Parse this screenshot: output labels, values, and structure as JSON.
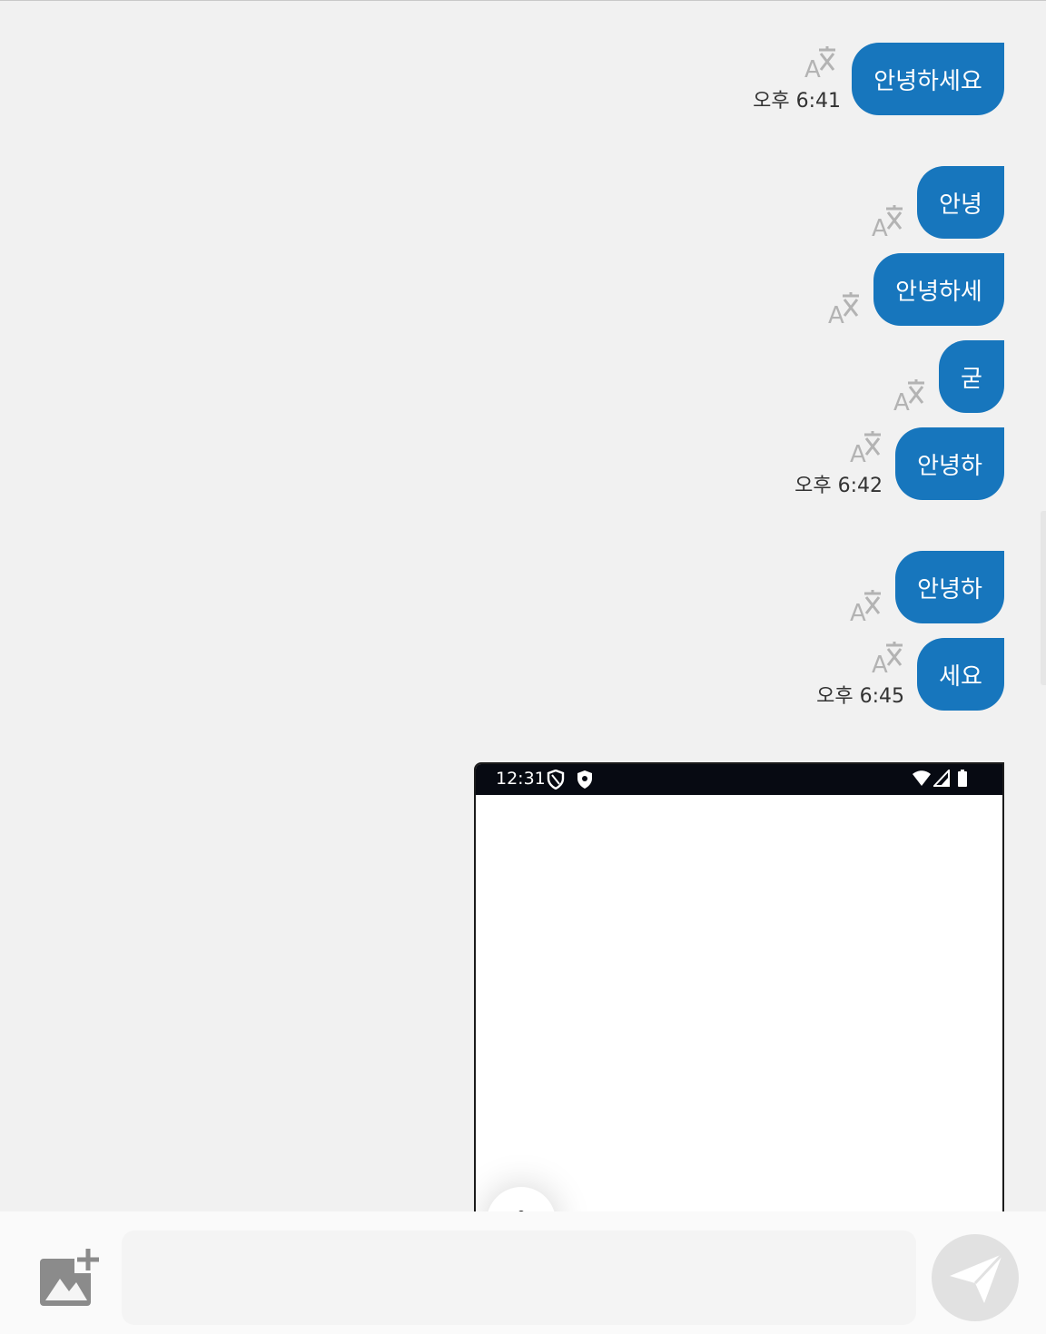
{
  "messages": [
    {
      "text": "안녕하세요",
      "time": "오후 6:41"
    },
    {
      "text": "안녕",
      "time": ""
    },
    {
      "text": "안녕하세",
      "time": ""
    },
    {
      "text": "굳",
      "time": ""
    },
    {
      "text": "안녕하",
      "time": "오후 6:42"
    },
    {
      "text": "안녕하",
      "time": ""
    },
    {
      "text": "세요",
      "time": "오후 6:45"
    }
  ],
  "screenshot_message": {
    "status_time": "12:31"
  },
  "composer": {
    "input_value": "",
    "input_placeholder": ""
  },
  "colors": {
    "bubble": "#1776bd",
    "background": "#f1f1f1",
    "translate_icon": "#b3b3b3",
    "send_button": "#e1e1e1"
  },
  "icons": {
    "translate": "translate-icon",
    "add_image": "add-image-icon",
    "send": "send-icon"
  }
}
